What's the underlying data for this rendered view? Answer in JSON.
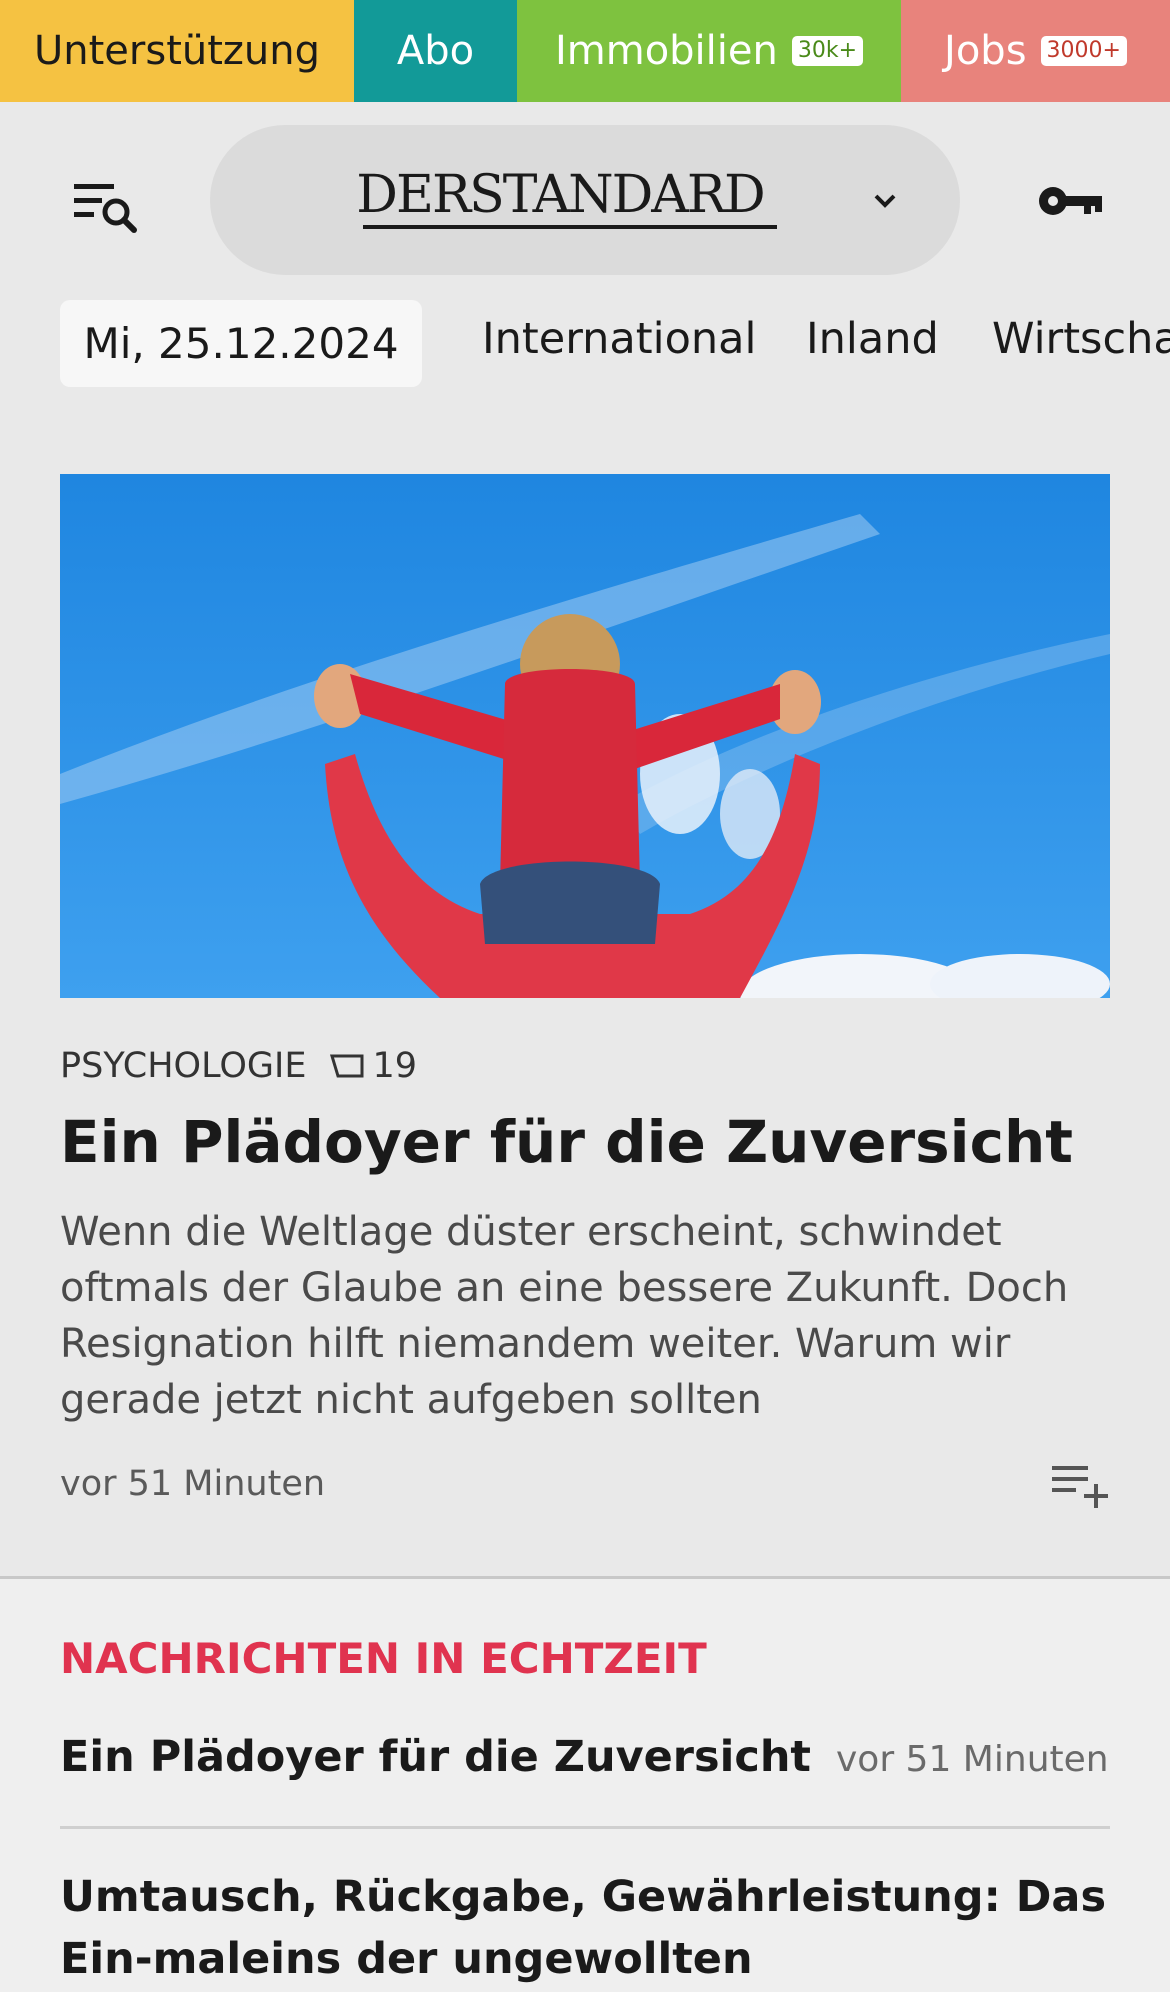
{
  "topbar": {
    "support": "Unterstützung",
    "abo": "Abo",
    "immobilien": "Immobilien",
    "immobilien_badge": "30k+",
    "jobs": "Jobs",
    "jobs_badge": "3000+"
  },
  "header": {
    "logo_text": "DERSTANDARD",
    "menu_icon": "menu-search-icon",
    "chevron_icon": "chevron-down-icon",
    "login_icon": "key-icon"
  },
  "nav": {
    "date": "Mi, 25.12.2024",
    "items": [
      "International",
      "Inland",
      "Wirtscha"
    ]
  },
  "article": {
    "kicker": "PSYCHOLOGIE",
    "comments": "19",
    "headline": "Ein Plädoyer für die Zuversicht",
    "teaser": "Wenn die Weltlage düster erscheint, schwindet oftmals der Glaube an eine bessere Zukunft. Doch Resignation hilft niemandem weiter. Warum wir gerade jetzt nicht aufgeben sollten",
    "time": "vor 51 Minuten",
    "playlist_icon": "playlist-add-icon"
  },
  "live": {
    "title": "NACHRICHTEN IN ECHTZEIT",
    "items": [
      {
        "headline": "Ein Plädoyer für die Zuversicht",
        "time": "vor 51 Minuten"
      },
      {
        "headline": "Umtausch, Rückgabe, Gewährleistung: Das Ein-maleins der ungewollten Weihnachtsgeschenke"
      }
    ]
  },
  "colors": {
    "support": "#f5c242",
    "abo": "#129a98",
    "immobilien": "#7ec23f",
    "jobs": "#e8837c",
    "live_title": "#e0334f"
  }
}
